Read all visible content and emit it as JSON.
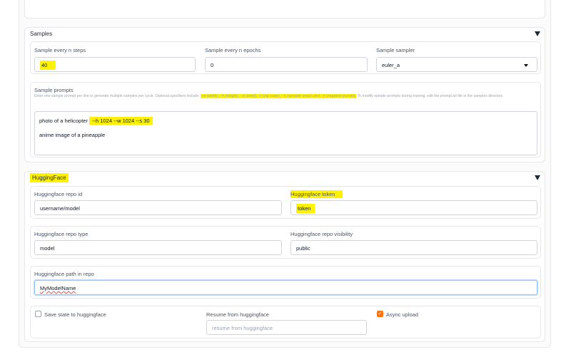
{
  "samples": {
    "title": "Samples",
    "every_n_steps": {
      "label": "Sample every n steps",
      "value": "40"
    },
    "every_n_epochs": {
      "label": "Sample every n epochs",
      "value": "0"
    },
    "sampler": {
      "label": "Sample sampler",
      "value": "euler_a"
    },
    "prompts": {
      "label": "Sample prompts",
      "desc_part1": "Enter one sample prompt per line to generate multiple samples per cycle. Optional specifiers include:",
      "desc_highlight": "--w (width), --h (height), --d (seed), --l (cfg scale), --s (sampler steps) and --n (negative prompt).",
      "desc_part2": "To modify sample prompts during training, edit the prompt.txt file in",
      "desc_part3": "the samples directory.",
      "line1_text": "photo of a helicopter",
      "line1_highlight": "--h 1024 --w 1024 --s 30",
      "line2": "anime image of a pineapple"
    }
  },
  "huggingface": {
    "title": "HuggingFace",
    "repo_id": {
      "label": "Huggingface repo id",
      "value": "username/model"
    },
    "token": {
      "label": "Huggingface token",
      "value": "token"
    },
    "repo_type": {
      "label": "Huggingface repo type",
      "value": "model"
    },
    "repo_visibility": {
      "label": "Huggingface repo visibility",
      "value": "public"
    },
    "path_in_repo": {
      "label": "Huggingface path in repo",
      "value": "MyModelName"
    },
    "save_state": {
      "label": "Save state to huggingface",
      "checked": false
    },
    "resume": {
      "label": "Resume from huggingface",
      "placeholder": "resume from huggingface"
    },
    "async_upload": {
      "label": "Async upload",
      "checked": true
    }
  },
  "colors": {
    "highlight": "#fff200",
    "accent": "#f97316"
  }
}
